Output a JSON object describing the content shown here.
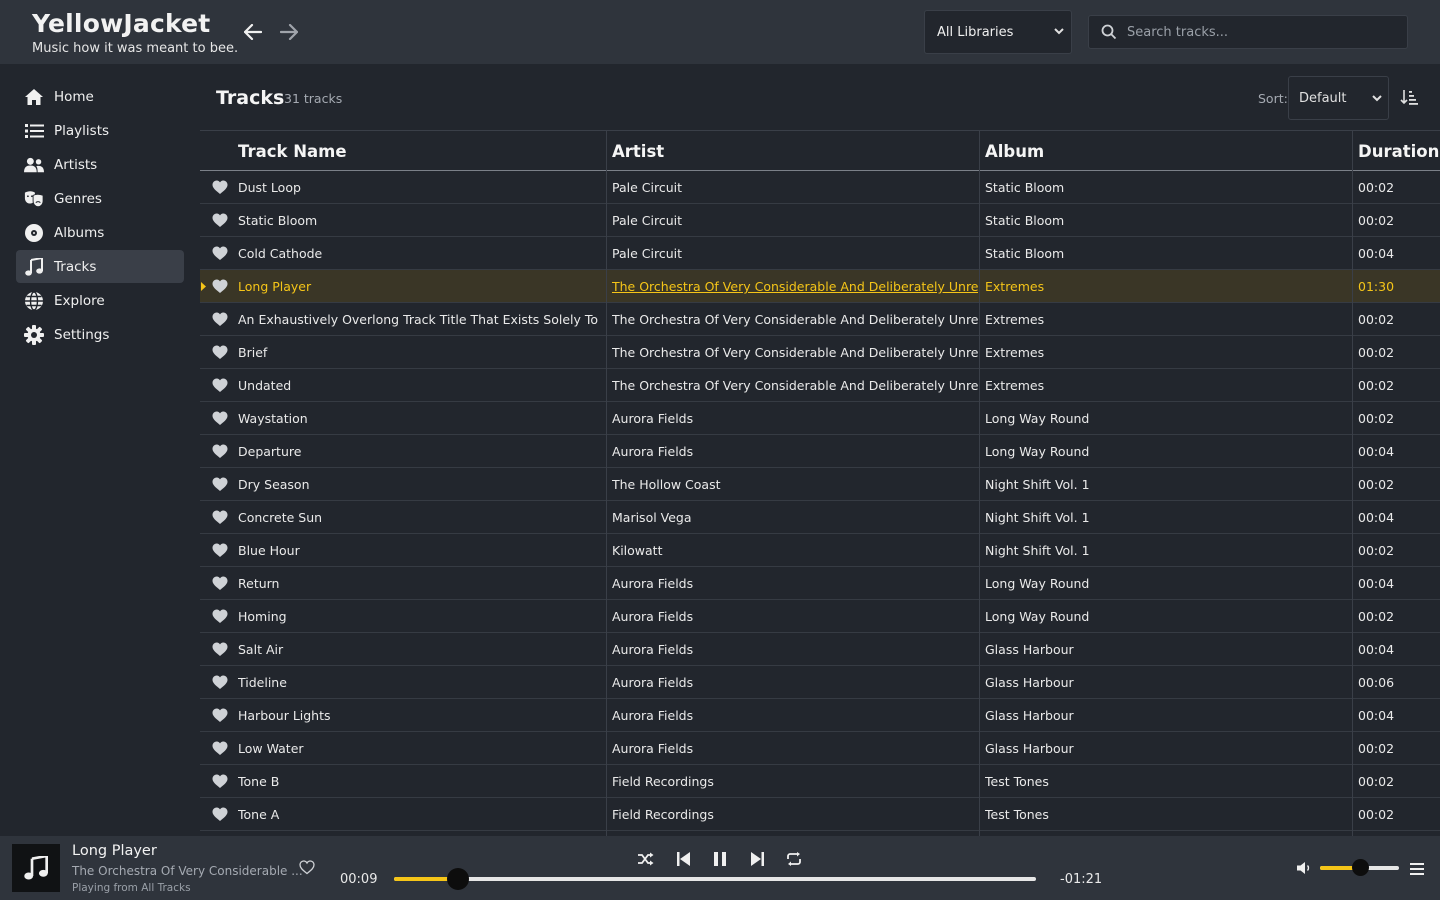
{
  "header": {
    "app_title": "YellowJacket",
    "tagline": "Music how it was meant to bee.",
    "library_select": "All Libraries",
    "search_placeholder": "Search tracks..."
  },
  "sidebar": {
    "items": [
      {
        "label": "Home",
        "icon": "home-icon"
      },
      {
        "label": "Playlists",
        "icon": "list-icon"
      },
      {
        "label": "Artists",
        "icon": "users-icon"
      },
      {
        "label": "Genres",
        "icon": "masks-icon"
      },
      {
        "label": "Albums",
        "icon": "disc-icon"
      },
      {
        "label": "Tracks",
        "icon": "music-note-icon",
        "active": true
      },
      {
        "label": "Explore",
        "icon": "globe-icon"
      },
      {
        "label": "Settings",
        "icon": "gear-icon"
      }
    ]
  },
  "main": {
    "title": "Tracks",
    "count": "31 tracks",
    "sort_label": "Sort:",
    "sort_value": "Default",
    "columns": [
      "Track Name",
      "Artist",
      "Album",
      "Duration"
    ],
    "rows": [
      {
        "name": "Dust Loop",
        "artist": "Pale Circuit",
        "album": "Static Bloom",
        "duration": "00:02"
      },
      {
        "name": "Static Bloom",
        "artist": "Pale Circuit",
        "album": "Static Bloom",
        "duration": "00:02"
      },
      {
        "name": "Cold Cathode",
        "artist": "Pale Circuit",
        "album": "Static Bloom",
        "duration": "00:04"
      },
      {
        "name": "Long Player",
        "artist": "The Orchestra Of Very Considerable And Deliberately Unreason...",
        "album": "Extremes",
        "duration": "01:30",
        "playing": true
      },
      {
        "name": "An Exhaustively Overlong Track Title That Exists Solely To Find ...",
        "artist": "The Orchestra Of Very Considerable And Deliberately Unreason...",
        "album": "Extremes",
        "duration": "00:02"
      },
      {
        "name": "Brief",
        "artist": "The Orchestra Of Very Considerable And Deliberately Unreason...",
        "album": "Extremes",
        "duration": "00:02"
      },
      {
        "name": "Undated",
        "artist": "The Orchestra Of Very Considerable And Deliberately Unreason...",
        "album": "Extremes",
        "duration": "00:02"
      },
      {
        "name": "Waystation",
        "artist": "Aurora Fields",
        "album": "Long Way Round",
        "duration": "00:02"
      },
      {
        "name": "Departure",
        "artist": "Aurora Fields",
        "album": "Long Way Round",
        "duration": "00:04"
      },
      {
        "name": "Dry Season",
        "artist": "The Hollow Coast",
        "album": "Night Shift Vol. 1",
        "duration": "00:02"
      },
      {
        "name": "Concrete Sun",
        "artist": "Marisol Vega",
        "album": "Night Shift Vol. 1",
        "duration": "00:04"
      },
      {
        "name": "Blue Hour",
        "artist": "Kilowatt",
        "album": "Night Shift Vol. 1",
        "duration": "00:02"
      },
      {
        "name": "Return",
        "artist": "Aurora Fields",
        "album": "Long Way Round",
        "duration": "00:04"
      },
      {
        "name": "Homing",
        "artist": "Aurora Fields",
        "album": "Long Way Round",
        "duration": "00:02"
      },
      {
        "name": "Salt Air",
        "artist": "Aurora Fields",
        "album": "Glass Harbour",
        "duration": "00:04"
      },
      {
        "name": "Tideline",
        "artist": "Aurora Fields",
        "album": "Glass Harbour",
        "duration": "00:06"
      },
      {
        "name": "Harbour Lights",
        "artist": "Aurora Fields",
        "album": "Glass Harbour",
        "duration": "00:04"
      },
      {
        "name": "Low Water",
        "artist": "Aurora Fields",
        "album": "Glass Harbour",
        "duration": "00:02"
      },
      {
        "name": "Tone B",
        "artist": "Field Recordings",
        "album": "Test Tones",
        "duration": "00:02"
      },
      {
        "name": "Tone A",
        "artist": "Field Recordings",
        "album": "Test Tones",
        "duration": "00:02"
      }
    ]
  },
  "player": {
    "title": "Long Player",
    "artist": "The Orchestra Of Very Considerable ...",
    "source": "Playing from All Tracks",
    "elapsed": "00:09",
    "remaining": "-01:21",
    "progress_fraction": 0.1,
    "volume_fraction": 0.5
  },
  "colors": {
    "accent": "#f5c518",
    "background": "#22262d",
    "header_bg": "#2f343c",
    "playing_row_bg": "#3a3626"
  }
}
